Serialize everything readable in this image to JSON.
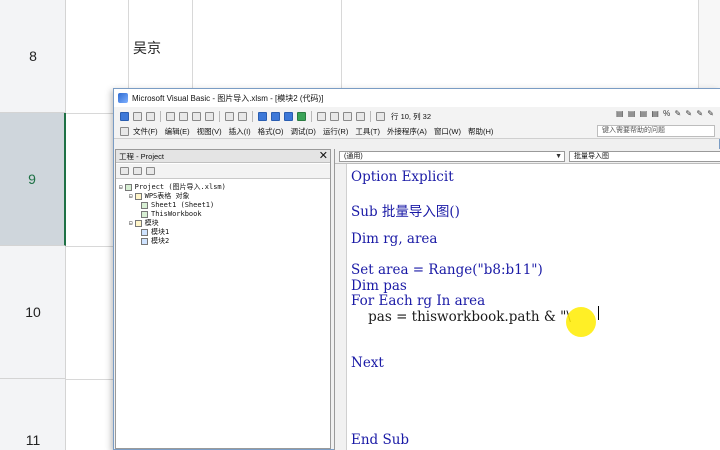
{
  "sheet": {
    "rows": [
      {
        "num": "8",
        "selected": false
      },
      {
        "num": "9",
        "selected": true
      },
      {
        "num": "10",
        "selected": false
      },
      {
        "num": "11",
        "selected": false
      }
    ],
    "cell_b8": "吴京"
  },
  "vbe": {
    "title": "Microsoft Visual Basic - 图片导入.xlsm - [模块2 (代码)]",
    "position_label": "行 10, 列 32",
    "menu": [
      "文件(F)",
      "编辑(E)",
      "视图(V)",
      "插入(I)",
      "格式(O)",
      "调试(D)",
      "运行(R)",
      "工具(T)",
      "外接程序(A)",
      "窗口(W)",
      "帮助(H)"
    ],
    "help_placeholder": "键入需要帮助的问题",
    "project_pane": {
      "title": "工程 - Project",
      "tree": [
        {
          "label": "Project (图片导入.xlsm)",
          "level": 0,
          "icon": "project-icon"
        },
        {
          "label": "WPS表格 对象",
          "level": 1,
          "icon": "folder-icon"
        },
        {
          "label": "Sheet1 (Sheet1)",
          "level": 2,
          "icon": "sheet-icon"
        },
        {
          "label": "ThisWorkbook",
          "level": 2,
          "icon": "workbook-icon"
        },
        {
          "label": "模块",
          "level": 1,
          "icon": "folder-icon"
        },
        {
          "label": "模块1",
          "level": 2,
          "icon": "module-icon"
        },
        {
          "label": "模块2",
          "level": 2,
          "icon": "module-icon"
        }
      ]
    },
    "code_pane": {
      "object_dropdown": "(通用)",
      "procedure_dropdown": "批量导入图",
      "lines": [
        "Option Explicit",
        "",
        "Sub 批量导入图()",
        "",
        "Dim rg, area",
        "",
        "Set area = Range(\"b8:b11\")",
        "Dim pas",
        "For Each rg In area",
        "    pas = thisworkbook.path & \"\\",
        "",
        "",
        "Next",
        "",
        "",
        "",
        "End Sub"
      ]
    }
  },
  "colors": {
    "selected_row_accent": "#1e7145",
    "title_border": "#7a9cc4",
    "cursor_highlight": "#ffec00"
  }
}
